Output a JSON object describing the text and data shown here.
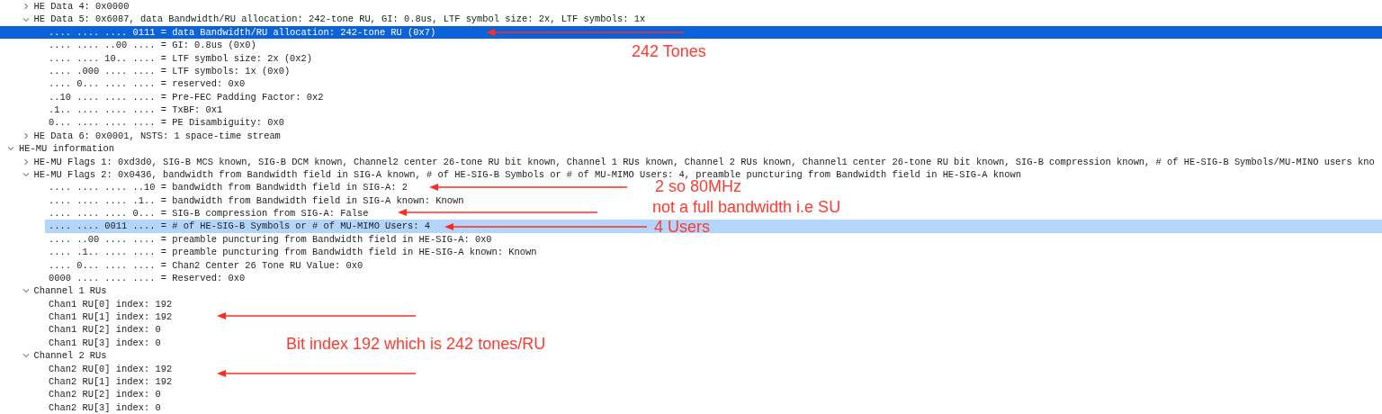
{
  "tree": [
    {
      "children": [
        {
          "label": "HE Data 4: 0x0000",
          "expanded": false,
          "selected": false,
          "related": false
        },
        {
          "label": "HE Data 5: 0x6087, data Bandwidth/RU allocation: 242-tone RU, GI: 0.8us, LTF symbol size: 2x, LTF symbols: 1x",
          "expanded": true,
          "selected": false,
          "related": false,
          "children": [
            {
              "label": ".... .... .... 0111 = data Bandwidth/RU allocation: 242-tone RU (0x7)",
              "selected": true,
              "related": false
            },
            {
              "label": ".... .... ..00 .... = GI: 0.8us (0x0)",
              "selected": false,
              "related": false
            },
            {
              "label": ".... .... 10.. .... = LTF symbol size: 2x (0x2)",
              "selected": false,
              "related": false
            },
            {
              "label": ".... .000 .... .... = LTF symbols: 1x (0x0)",
              "selected": false,
              "related": false
            },
            {
              "label": ".... 0... .... .... = reserved: 0x0",
              "selected": false,
              "related": false
            },
            {
              "label": "..10 .... .... .... = Pre-FEC Padding Factor: 0x2",
              "selected": false,
              "related": false
            },
            {
              "label": ".1.. .... .... .... = TxBF: 0x1",
              "selected": false,
              "related": false
            },
            {
              "label": "0... .... .... .... = PE Disambiguity: 0x0",
              "selected": false,
              "related": false
            }
          ]
        },
        {
          "label": "HE Data 6: 0x0001, NSTS: 1 space-time stream",
          "expanded": false,
          "selected": false,
          "related": false
        }
      ]
    },
    {
      "label": "HE-MU information",
      "expanded": true,
      "selected": false,
      "related": false,
      "children": [
        {
          "label": "HE-MU Flags 1: 0xd3d0, SIG-B MCS known, SIG-B DCM known, Channel2 center 26-tone RU bit known, Channel 1 RUs known, Channel 2 RUs known, Channel1 center 26-tone RU bit known, SIG-B compression known, # of HE-SIG-B Symbols/MU-MINO users kno",
          "expanded": false,
          "selected": false,
          "related": false
        },
        {
          "label": "HE-MU Flags 2: 0x0436, bandwidth from Bandwidth field in SIG-A known, # of HE-SIG-B Symbols or # of MU-MIMO Users: 4, preamble puncturing from Bandwidth field in HE-SIG-A known",
          "expanded": true,
          "selected": false,
          "related": false,
          "children": [
            {
              "label": ".... .... .... ..10 = bandwidth from Bandwidth field in SIG-A: 2",
              "selected": false,
              "related": false
            },
            {
              "label": ".... .... .... .1.. = bandwidth from Bandwidth field in SIG-A known: Known",
              "selected": false,
              "related": false
            },
            {
              "label": ".... .... .... 0... = SIG-B compression from SIG-A: False",
              "selected": false,
              "related": false
            },
            {
              "label": ".... .... 0011 .... = # of HE-SIG-B Symbols or # of MU-MIMO Users: 4",
              "selected": false,
              "related": true
            },
            {
              "label": ".... ..00 .... .... = preamble puncturing from Bandwidth field in HE-SIG-A: 0x0",
              "selected": false,
              "related": false
            },
            {
              "label": ".... .1.. .... .... = preamble puncturing from Bandwidth field in HE-SIG-A known: Known",
              "selected": false,
              "related": false
            },
            {
              "label": ".... 0... .... .... = Chan2 Center 26 Tone RU Value: 0x0",
              "selected": false,
              "related": false
            },
            {
              "label": "0000 .... .... .... = Reserved: 0x0",
              "selected": false,
              "related": false
            }
          ]
        },
        {
          "label": "Channel 1 RUs",
          "expanded": true,
          "selected": false,
          "related": false,
          "children": [
            {
              "label": "Chan1 RU[0] index: 192",
              "selected": false,
              "related": false
            },
            {
              "label": "Chan1 RU[1] index: 192",
              "selected": false,
              "related": false
            },
            {
              "label": "Chan1 RU[2] index: 0",
              "selected": false,
              "related": false
            },
            {
              "label": "Chan1 RU[3] index: 0",
              "selected": false,
              "related": false
            }
          ]
        },
        {
          "label": "Channel 2 RUs",
          "expanded": true,
          "selected": false,
          "related": false,
          "children": [
            {
              "label": "Chan2 RU[0] index: 192",
              "selected": false,
              "related": false
            },
            {
              "label": "Chan2 RU[1] index: 192",
              "selected": false,
              "related": false
            },
            {
              "label": "Chan2 RU[2] index: 0",
              "selected": false,
              "related": false
            },
            {
              "label": "Chan2 RU[3] index: 0",
              "selected": false,
              "related": false
            }
          ]
        }
      ]
    }
  ],
  "annotations": [
    {
      "text": "242 Tones"
    },
    {
      "text": "2 so 80MHz"
    },
    {
      "text": "not a full bandwidth i.e SU"
    },
    {
      "text": "4 Users"
    },
    {
      "text": "Bit index 192 which is 242 tones/RU"
    }
  ]
}
